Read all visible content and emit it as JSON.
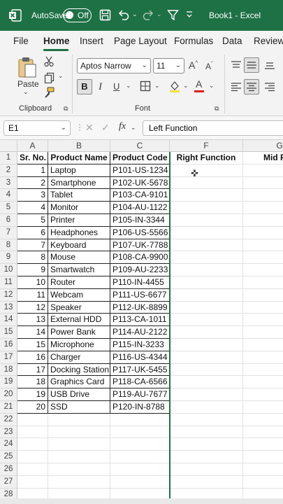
{
  "titlebar": {
    "autosave_label": "AutoSave",
    "autosave_state": "Off",
    "document_title": "Book1  -  Excel"
  },
  "menu": [
    "File",
    "Home",
    "Insert",
    "Page Layout",
    "Formulas",
    "Data",
    "Review"
  ],
  "ribbon": {
    "paste_label": "Paste",
    "clipboard_label": "Clipboard",
    "font_label": "Font",
    "font_name": "Aptos Narrow",
    "font_size": "11"
  },
  "formula_bar": {
    "name_box": "E1",
    "fx": "fx",
    "content": "Left Function"
  },
  "columns": [
    "A",
    "B",
    "C",
    "F",
    "G"
  ],
  "headers": {
    "sr": "Sr. No.",
    "name": "Product Name",
    "code": "Product Code",
    "right": "Right Function",
    "mid": "Mid Fun"
  },
  "rows": [
    {
      "n": 1,
      "name": "Laptop",
      "code": "P101-US-1234"
    },
    {
      "n": 2,
      "name": "Smartphone",
      "code": "P102-UK-5678"
    },
    {
      "n": 3,
      "name": "Tablet",
      "code": "P103-CA-9101"
    },
    {
      "n": 4,
      "name": "Monitor",
      "code": "P104-AU-1122"
    },
    {
      "n": 5,
      "name": "Printer",
      "code": "P105-IN-3344"
    },
    {
      "n": 6,
      "name": "Headphones",
      "code": "P106-US-5566"
    },
    {
      "n": 7,
      "name": "Keyboard",
      "code": "P107-UK-7788"
    },
    {
      "n": 8,
      "name": "Mouse",
      "code": "P108-CA-9900"
    },
    {
      "n": 9,
      "name": "Smartwatch",
      "code": "P109-AU-2233"
    },
    {
      "n": 10,
      "name": "Router",
      "code": "P110-IN-4455"
    },
    {
      "n": 11,
      "name": "Webcam",
      "code": "P111-US-6677"
    },
    {
      "n": 12,
      "name": "Speaker",
      "code": "P112-UK-8899"
    },
    {
      "n": 13,
      "name": "External HDD",
      "code": "P113-CA-1011"
    },
    {
      "n": 14,
      "name": "Power Bank",
      "code": "P114-AU-2122"
    },
    {
      "n": 15,
      "name": "Microphone",
      "code": "P115-IN-3233"
    },
    {
      "n": 16,
      "name": "Charger",
      "code": "P116-US-4344"
    },
    {
      "n": 17,
      "name": "Docking Station",
      "code": "P117-UK-5455"
    },
    {
      "n": 18,
      "name": "Graphics Card",
      "code": "P118-CA-6566"
    },
    {
      "n": 19,
      "name": "USB Drive",
      "code": "P119-AU-7677"
    },
    {
      "n": 20,
      "name": "SSD",
      "code": "P120-IN-8788"
    }
  ],
  "row_numbers": [
    "1",
    "2",
    "3",
    "4",
    "5",
    "6",
    "7",
    "8",
    "9",
    "10",
    "11",
    "12",
    "13",
    "14",
    "15",
    "16",
    "17",
    "18",
    "19",
    "20",
    "21",
    "22",
    "23",
    "24",
    "25",
    "26",
    "27",
    "28"
  ],
  "colors": {
    "brand": "#1e7145",
    "ribbon_bg": "#f3f3f3"
  }
}
